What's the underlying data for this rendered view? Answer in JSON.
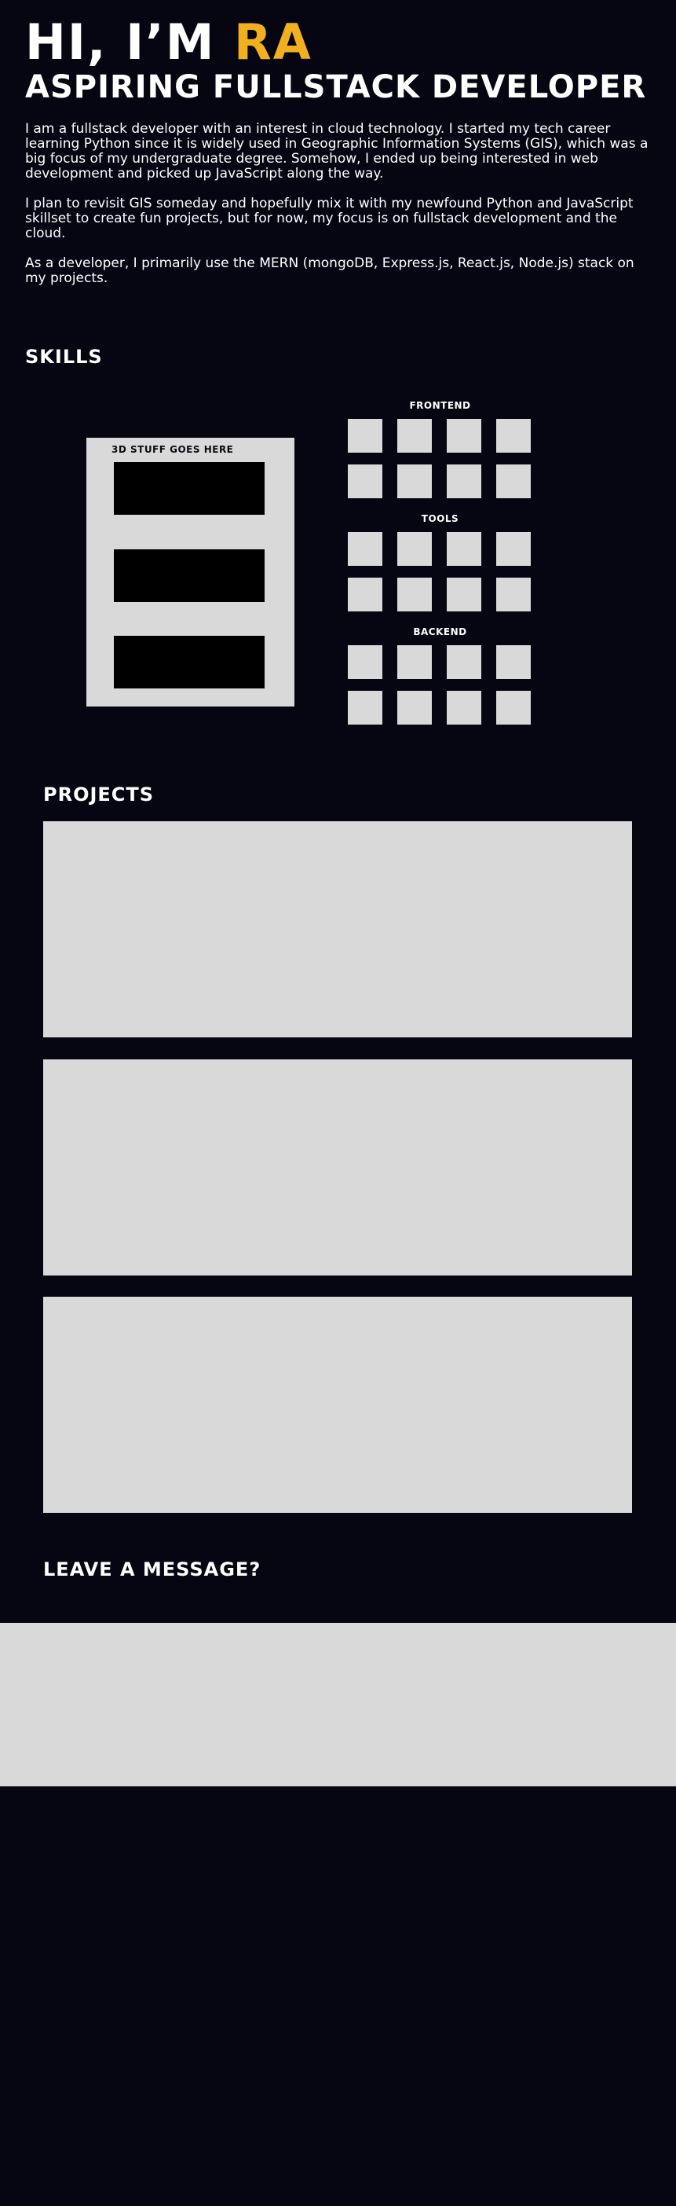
{
  "hero": {
    "greeting": "HI, I’M ",
    "name": "RA",
    "subtitle": "ASPIRING FULLSTACK DEVELOPER"
  },
  "about": {
    "paragraphs": [
      "I am a fullstack developer with an interest in cloud technology. I started my tech career learning Python since it is widely used in Geographic Information Systems (GIS), which was a big focus of my undergraduate degree. Somehow, I ended up being interested in web development and picked up JavaScript along the way.",
      "I plan to revisit GIS someday and hopefully mix it with my newfound Python and JavaScript skillset to create fun projects, but for now, my focus is on fullstack development and the cloud.",
      "As a developer, I primarily use the MERN (mongoDB, Express.js, React.js, Node.js) stack on my projects."
    ]
  },
  "skills": {
    "title": "SKILLS",
    "threed_placeholder": "3D STUFF GOES HERE",
    "groups": [
      {
        "label": "FRONTEND",
        "tiles": 8
      },
      {
        "label": "TOOLS",
        "tiles": 8
      },
      {
        "label": "BACKEND",
        "tiles": 8
      }
    ]
  },
  "projects": {
    "title": "PROJECTS",
    "count": 3
  },
  "message": {
    "title": "LEAVE A MESSAGE?"
  },
  "colors": {
    "background": "#060612",
    "accent": "#f2b01e",
    "placeholder": "#d9d9d9",
    "text": "#ffffff"
  }
}
